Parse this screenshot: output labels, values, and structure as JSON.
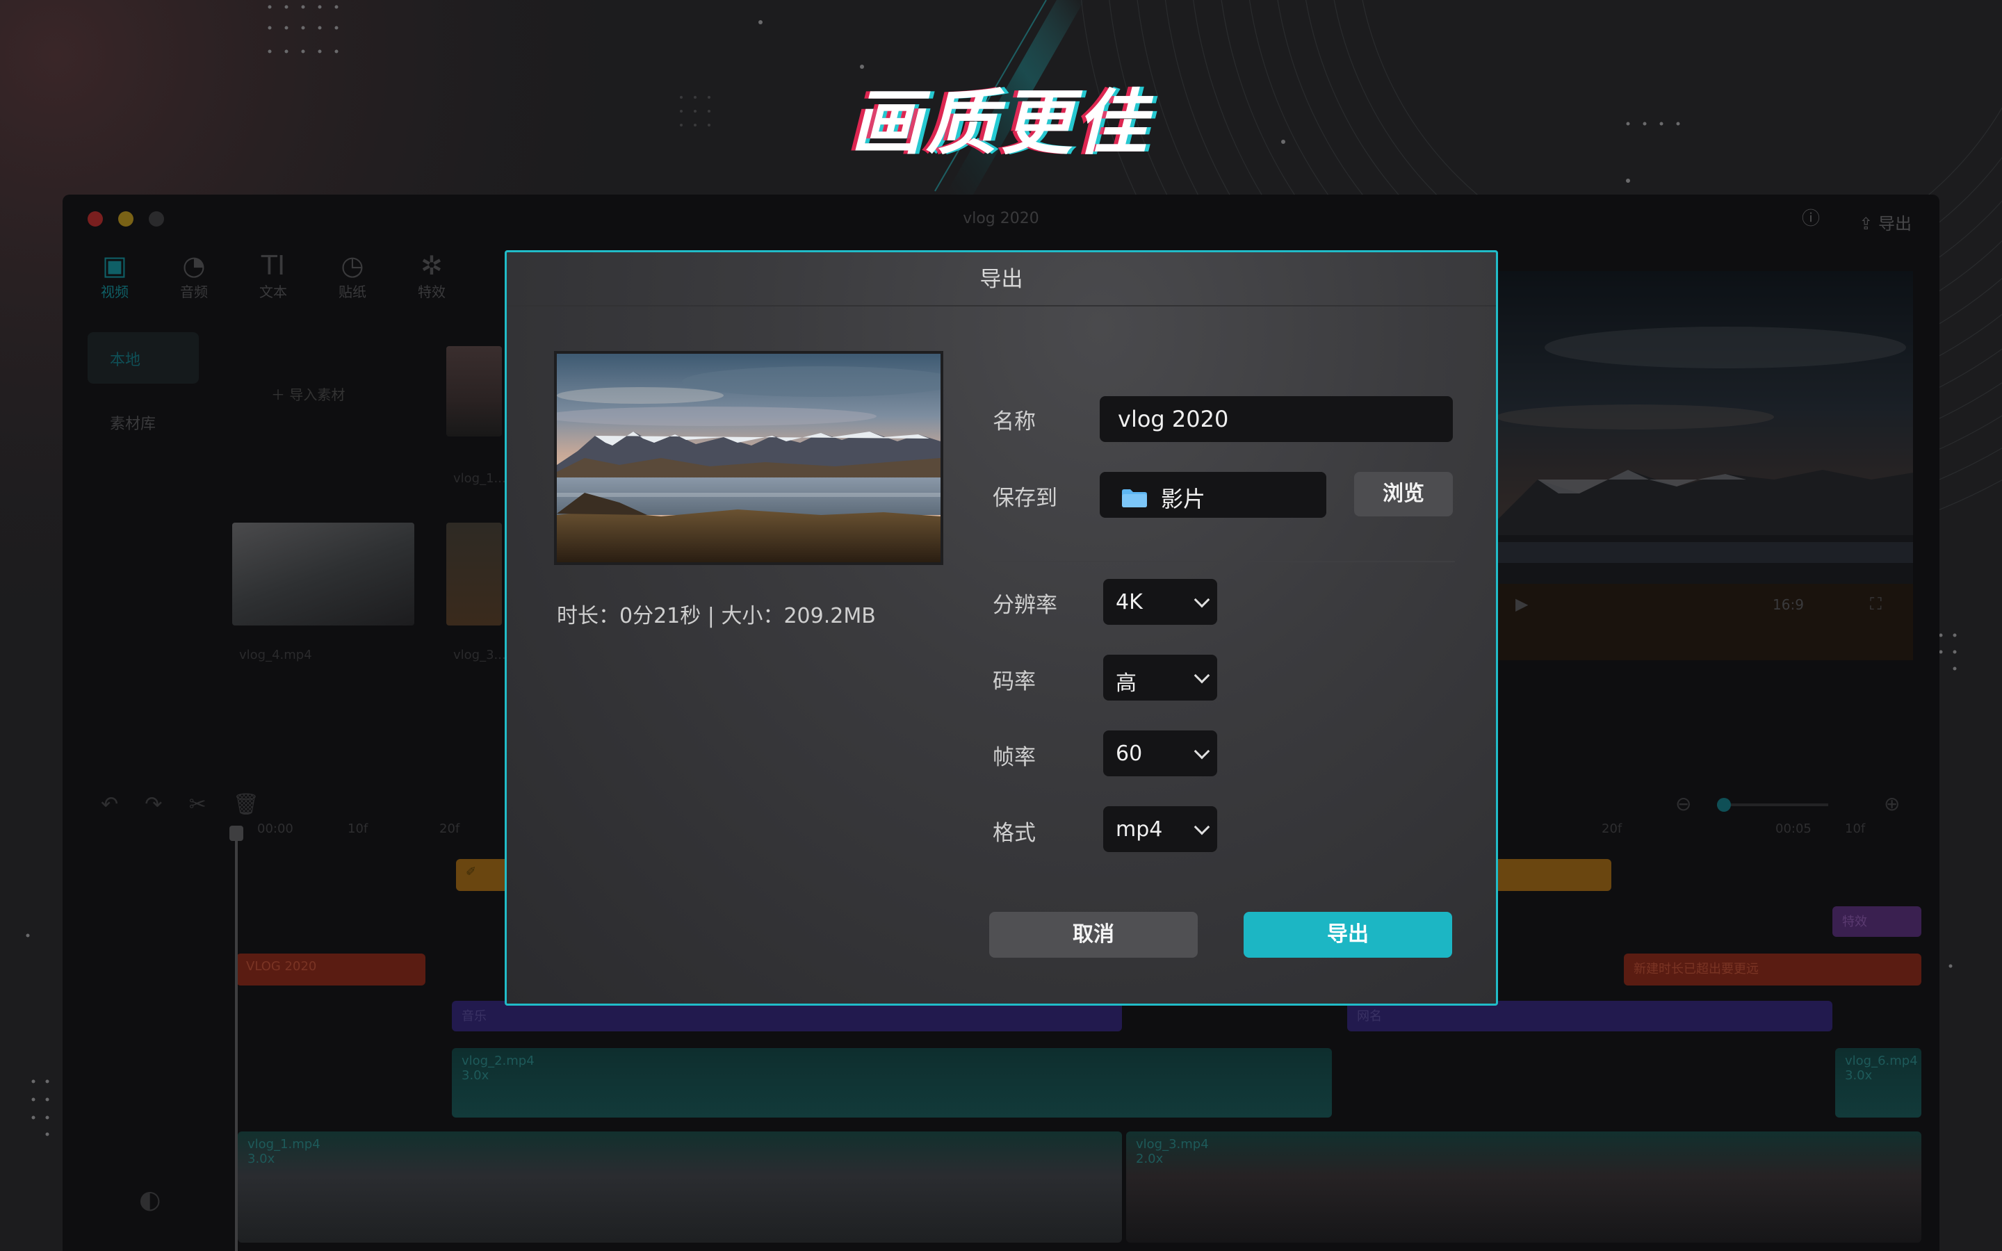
{
  "headline": "画质更佳",
  "window": {
    "title": "vlog 2020",
    "export_label": "导出",
    "tools": [
      {
        "icon": "media-icon",
        "label": "视频",
        "active": true
      },
      {
        "icon": "audio-icon",
        "label": "音频"
      },
      {
        "icon": "text-icon",
        "label": "文本"
      },
      {
        "icon": "sticker-icon",
        "label": "贴纸"
      },
      {
        "icon": "effects-icon",
        "label": "特效"
      }
    ],
    "sidebar": [
      {
        "label": "本地",
        "active": true
      },
      {
        "label": "素材库"
      }
    ],
    "import_label": "导入素材",
    "media": [
      {
        "caption": "vlog_4.mp4"
      },
      {
        "caption": "vlog_3..."
      },
      {
        "caption": "vlog_1..."
      }
    ],
    "preview_ratio": "16:9",
    "timeline": {
      "ruler": [
        "00:00",
        "10f",
        "20f",
        "00:05",
        "10f",
        "20f"
      ],
      "text_clip": "VLOG 2020",
      "text_clip_2": "新建时长已超出要更远",
      "audio_clip_1": "音乐",
      "audio_clip_2": "网名",
      "effect_clip": "特效",
      "video_clip_2": "vlog_2.mp4",
      "video_clip_2_speed": "3.0x",
      "video_clip_6": "vlog_6.mp4",
      "video_clip_6_speed": "3.0x",
      "main_clip_1": "vlog_1.mp4",
      "main_clip_1_speed": "3.0x",
      "main_clip_3": "vlog_3.mp4",
      "main_clip_3_speed": "2.0x"
    }
  },
  "dialog": {
    "title": "导出",
    "meta": "时长：0分21秒 | 大小：209.2MB",
    "name_label": "名称",
    "name_value": "vlog 2020",
    "save_label": "保存到",
    "save_value": "影片",
    "browse_label": "浏览",
    "resolution_label": "分辨率",
    "resolution_value": "4K",
    "bitrate_label": "码率",
    "bitrate_value": "高",
    "framerate_label": "帧率",
    "framerate_value": "60",
    "format_label": "格式",
    "format_value": "mp4",
    "cancel_label": "取消",
    "export_label": "导出"
  },
  "colors": {
    "accent": "#1cb6c4",
    "dialog_border": "#21bcc8"
  }
}
